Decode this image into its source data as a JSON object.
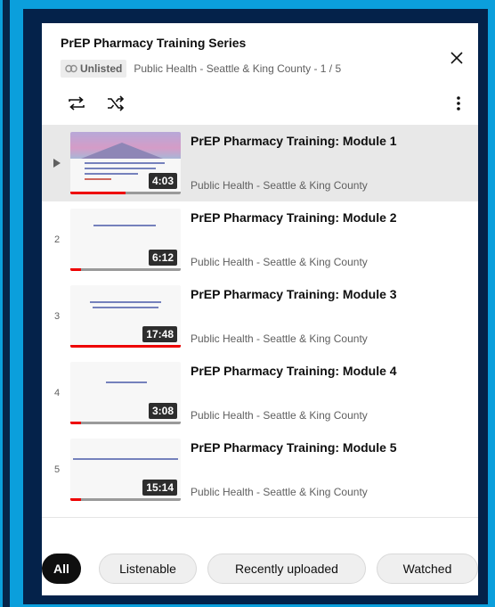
{
  "playlist": {
    "title": "PrEP Pharmacy Training Series",
    "visibility": "Unlisted",
    "channel_position": "Public Health - Seattle & King County - 1 / 5"
  },
  "items": [
    {
      "index": "▸",
      "title": "PrEP Pharmacy Training: Module 1",
      "channel": "Public Health - Seattle & King County",
      "duration": "4:03",
      "progress": 0.5,
      "active": true
    },
    {
      "index": "2",
      "title": "PrEP Pharmacy Training: Module 2",
      "channel": "Public Health - Seattle & King County",
      "duration": "6:12",
      "progress": 0.1,
      "active": false
    },
    {
      "index": "3",
      "title": "PrEP Pharmacy Training: Module 3",
      "channel": "Public Health - Seattle & King County",
      "duration": "17:48",
      "progress": 1.0,
      "active": false
    },
    {
      "index": "4",
      "title": "PrEP Pharmacy Training: Module 4",
      "channel": "Public Health - Seattle & King County",
      "duration": "3:08",
      "progress": 0.1,
      "active": false
    },
    {
      "index": "5",
      "title": "PrEP Pharmacy Training: Module 5",
      "channel": "Public Health - Seattle & King County",
      "duration": "15:14",
      "progress": 0.1,
      "active": false
    }
  ],
  "chips": [
    "All",
    "Listenable",
    "Recently uploaded",
    "Watched"
  ],
  "colors": {
    "accent": "#0b9fdc",
    "progress": "#ee0000"
  },
  "icons": [
    "link-icon",
    "close-icon",
    "loop-icon",
    "shuffle-icon",
    "more-vert-icon",
    "play-indicator-icon"
  ]
}
